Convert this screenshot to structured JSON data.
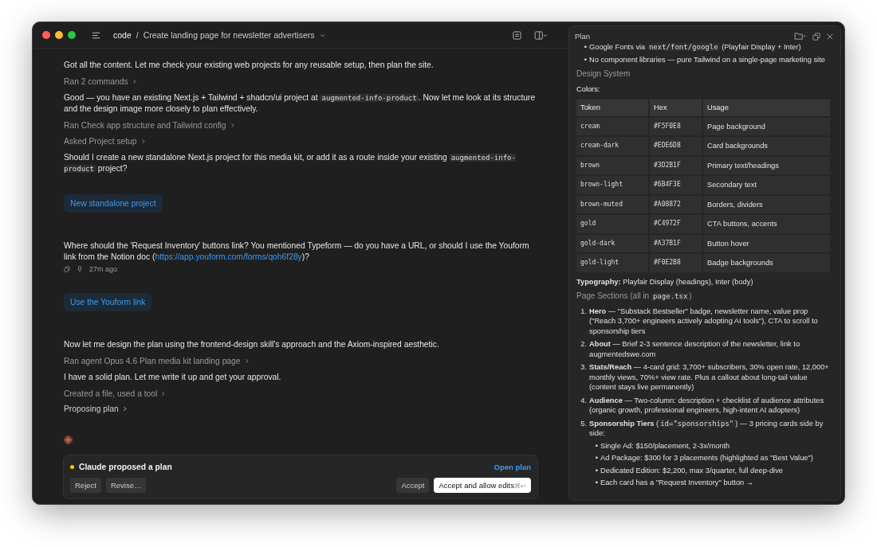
{
  "window": {
    "project": "code",
    "separator": "/",
    "title": "Create landing page for newsletter advertisers"
  },
  "messages": [
    {
      "kind": "text",
      "parts": [
        {
          "kind": "text",
          "text": "Got all the content. Let me check your existing web projects for any reusable setup, then plan the site."
        }
      ]
    },
    {
      "kind": "step",
      "label": "Ran 2 commands"
    },
    {
      "kind": "text",
      "parts": [
        {
          "kind": "text",
          "text": "Good — you have an existing Next.js + Tailwind + shadcn/ui project at "
        },
        {
          "kind": "code",
          "text": "augmented-info-product"
        },
        {
          "kind": "text",
          "text": ". Now let me look at its structure and the design image more closely to plan effectively."
        }
      ]
    },
    {
      "kind": "step",
      "label": "Ran Check app structure and Tailwind config"
    },
    {
      "kind": "step",
      "label": "Asked Project setup"
    },
    {
      "kind": "text",
      "parts": [
        {
          "kind": "text",
          "text": "Should I create a new standalone Next.js project for this media kit, or add it as a route inside your existing "
        },
        {
          "kind": "code",
          "text": "augmented-info-product"
        },
        {
          "kind": "text",
          "text": " project?"
        }
      ]
    },
    {
      "kind": "choice",
      "label": "New standalone project"
    },
    {
      "kind": "text",
      "parts": [
        {
          "kind": "text",
          "text": "Where should the 'Request Inventory' buttons link? You mentioned Typeform — do you have a URL, or should I use the Youform link from the Notion doc ("
        },
        {
          "kind": "link",
          "text": "https://app.youform.com/forms/qoh6f28y"
        },
        {
          "kind": "text",
          "text": ")?"
        }
      ]
    },
    {
      "kind": "meta",
      "time": "27m ago"
    },
    {
      "kind": "choice",
      "label": "Use the Youform link"
    },
    {
      "kind": "text",
      "parts": [
        {
          "kind": "text",
          "text": "Now let me design the plan using the frontend-design skill's approach and the Axiom-inspired aesthetic."
        }
      ]
    },
    {
      "kind": "step",
      "label": "Ran agent Opus 4.6 Plan media kit landing page"
    },
    {
      "kind": "text",
      "parts": [
        {
          "kind": "text",
          "text": "I have a solid plan. Let me write it up and get your approval."
        }
      ]
    },
    {
      "kind": "step",
      "label": "Created a file, used a tool"
    },
    {
      "kind": "step_light",
      "label": "Proposing plan"
    },
    {
      "kind": "spinner"
    }
  ],
  "proposal": {
    "title": "Claude proposed a plan",
    "open_label": "Open plan",
    "buttons": [
      {
        "label": "Reject",
        "kind": "secondary"
      },
      {
        "label": "Revise…",
        "kind": "secondary"
      },
      {
        "label": "Accept",
        "kind": "secondary"
      },
      {
        "label": "Accept and allow edits",
        "kind": "primary",
        "shortcut": "⌘↩"
      }
    ]
  },
  "plan": {
    "title": "Plan",
    "bullets": [
      {
        "marker": "•",
        "parts": [
          {
            "kind": "text",
            "text": "Google Fonts via "
          },
          {
            "kind": "code",
            "text": "next/font/google"
          },
          {
            "kind": "text",
            "text": " (Playfair Display + Inter)"
          }
        ]
      },
      {
        "marker": "•",
        "parts": [
          {
            "kind": "text",
            "text": "No component libraries — pure Tailwind on a single-page marketing site"
          }
        ]
      }
    ],
    "heading": "Design System",
    "colors_label": "Colors:",
    "table": {
      "columns": [
        "Token",
        "Hex",
        "Usage"
      ],
      "rows": [
        [
          "cream",
          "#F5F0E8",
          "Page background"
        ],
        [
          "cream-dark",
          "#EDE6D8",
          "Card backgrounds"
        ],
        [
          "brown",
          "#3D2B1F",
          "Primary text/headings"
        ],
        [
          "brown-light",
          "#6B4F3E",
          "Secondary text"
        ],
        [
          "brown-muted",
          "#A08872",
          "Borders, dividers"
        ],
        [
          "gold",
          "#C4972F",
          "CTA buttons, accents"
        ],
        [
          "gold-dark",
          "#A37B1F",
          "Button hover"
        ],
        [
          "gold-light",
          "#F0E2B8",
          "Badge backgrounds"
        ]
      ]
    },
    "typography": "**Typography:** Playfair Display (headings), Inter (body)",
    "sections_heading": [
      {
        "kind": "text",
        "text": "Page Sections (all in "
      },
      {
        "kind": "code",
        "text": "page.tsx"
      },
      {
        "kind": "text",
        "text": ")"
      }
    ],
    "sections": [
      {
        "marker": "1.",
        "parts": [
          {
            "kind": "text",
            "text": "**Hero** — \"Substack Bestseller\" badge, newsletter name, value prop (\"Reach 3,700+ engineers actively adopting AI tools\"), CTA to scroll to sponsorship tiers"
          }
        ]
      },
      {
        "marker": "2.",
        "parts": [
          {
            "kind": "text",
            "text": "**About** — Brief 2-3 sentence description of the newsletter, link to augmentedswe.com"
          }
        ]
      },
      {
        "marker": "3.",
        "parts": [
          {
            "kind": "text",
            "text": "**Stats/Reach** — 4-card grid: 3,700+ subscribers, 30% open rate, 12,000+ monthly views, 70%+ view rate. Plus a callout about long-tail value (content stays live permanently)"
          }
        ]
      },
      {
        "marker": "4.",
        "parts": [
          {
            "kind": "text",
            "text": "**Audience** — Two-column: description + checklist of audience attributes (organic growth, professional engineers, high-intent AI adopters)"
          }
        ]
      },
      {
        "marker": "5.",
        "parts": [
          {
            "kind": "text",
            "text": "**Sponsorship Tiers** ("
          },
          {
            "kind": "code",
            "text": "id=\"sponsorships\""
          },
          {
            "kind": "text",
            "text": ") — 3 pricing cards side by side:"
          }
        ],
        "children": [
          {
            "marker": "•",
            "text": "Single Ad: $150/placement, 2-3x/month"
          },
          {
            "marker": "•",
            "text": "Ad Package: $300 for 3 placements (highlighted as \"Best Value\")"
          },
          {
            "marker": "•",
            "text": "Dedicated Edition: $2,200, max 3/quarter, full deep-dive"
          },
          {
            "marker": "•",
            "text": "Each card has a \"Request Inventory\" button →"
          }
        ]
      }
    ]
  }
}
